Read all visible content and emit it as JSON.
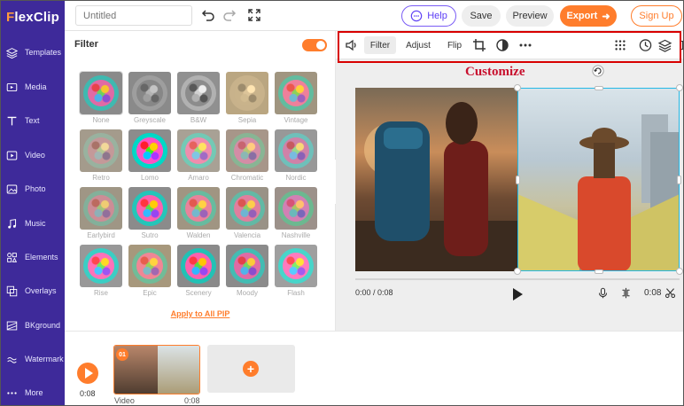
{
  "app": {
    "logo_first": "F",
    "logo_rest": "lexClip",
    "title_placeholder": "Untitled"
  },
  "sidebar": {
    "items": [
      {
        "label": "Templates",
        "icon": "layers-icon"
      },
      {
        "label": "Media",
        "icon": "media-icon"
      },
      {
        "label": "Text",
        "icon": "text-icon"
      },
      {
        "label": "Video",
        "icon": "video-icon"
      },
      {
        "label": "Photo",
        "icon": "photo-icon"
      },
      {
        "label": "Music",
        "icon": "music-icon"
      },
      {
        "label": "Elements",
        "icon": "elements-icon"
      },
      {
        "label": "Overlays",
        "icon": "overlays-icon"
      },
      {
        "label": "BKground",
        "icon": "background-icon"
      },
      {
        "label": "Watermark",
        "icon": "watermark-icon"
      },
      {
        "label": "More",
        "icon": "more-dots-icon"
      }
    ]
  },
  "topbar": {
    "help": "Help",
    "save": "Save",
    "preview": "Preview",
    "export": "Export",
    "signup": "Sign Up"
  },
  "filter_panel": {
    "title": "Filter",
    "enabled": true,
    "filters": [
      {
        "label": "None",
        "css": "none"
      },
      {
        "label": "Greyscale",
        "css": "grayscale(1)"
      },
      {
        "label": "B&W",
        "css": "grayscale(1) contrast(1.6)"
      },
      {
        "label": "Sepia",
        "css": "sepia(1)"
      },
      {
        "label": "Vintage",
        "css": "sepia(0.4) saturate(1.4)"
      },
      {
        "label": "Retro",
        "css": "sepia(0.6) saturate(0.7)"
      },
      {
        "label": "Lomo",
        "css": "saturate(1.6) contrast(1.2)"
      },
      {
        "label": "Amaro",
        "css": "sepia(0.3) brightness(1.1)"
      },
      {
        "label": "Chromatic",
        "css": "sepia(0.5) hue-rotate(-15deg)"
      },
      {
        "label": "Nordic",
        "css": "saturate(0.6) brightness(1.1)"
      },
      {
        "label": "Earlybird",
        "css": "sepia(0.5) contrast(0.9)"
      },
      {
        "label": "Sutro",
        "css": "saturate(1.2) contrast(1.1)"
      },
      {
        "label": "Walden",
        "css": "sepia(0.4) saturate(1.3)"
      },
      {
        "label": "Valencia",
        "css": "sepia(0.3) saturate(1.1)"
      },
      {
        "label": "Nashville",
        "css": "sepia(0.3) hue-rotate(-20deg)"
      },
      {
        "label": "Rise",
        "css": "brightness(1.1) saturate(1.1)"
      },
      {
        "label": "Epic",
        "css": "sepia(0.5) saturate(1.5)"
      },
      {
        "label": "Scenery",
        "css": "saturate(1.3)"
      },
      {
        "label": "Moody",
        "css": "saturate(0.9) contrast(1.1)"
      },
      {
        "label": "Flash",
        "css": "brightness(1.15)"
      }
    ],
    "apply_all": "Apply to All PIP"
  },
  "toolbar": {
    "filter": "Filter",
    "adjust": "Adjust",
    "flip": "Flip"
  },
  "annotation": {
    "label": "Customize"
  },
  "player": {
    "current": "0:00 / 0:08",
    "duration": "0:08"
  },
  "timeline": {
    "time": "0:08",
    "clip_number": "01",
    "clip_label": "Video",
    "clip_duration": "0:08"
  },
  "colors": {
    "accent": "#ff7d2c",
    "sidebar": "#3e2a9a",
    "selection": "#25b9e6",
    "annotation": "#d80000"
  }
}
